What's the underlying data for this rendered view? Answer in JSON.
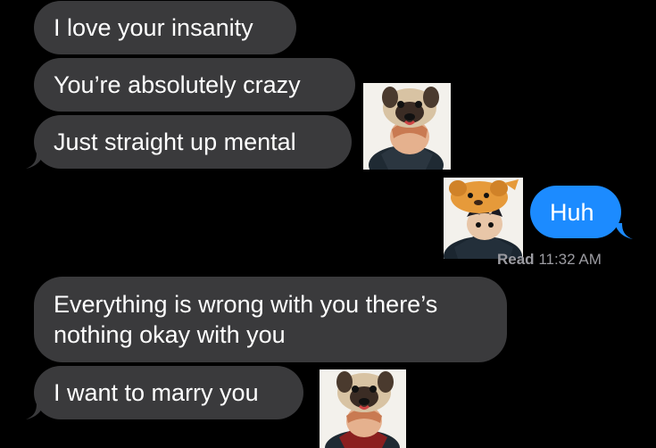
{
  "conversation": {
    "messages": [
      {
        "direction": "incoming",
        "text": "I love your insanity"
      },
      {
        "direction": "incoming",
        "text": "You’re absolutely crazy"
      },
      {
        "direction": "incoming",
        "text": "Just straight up mental"
      },
      {
        "direction": "outgoing",
        "text": "Huh"
      },
      {
        "direction": "incoming",
        "line1": "Everything is wrong with you there’s",
        "line2": "nothing okay with you"
      },
      {
        "direction": "incoming",
        "text": "I want to marry you"
      }
    ],
    "read_receipt": {
      "status": "Read",
      "time": "11:32 AM"
    },
    "colors": {
      "background": "#000000",
      "incoming_bubble": "#3a3a3c",
      "outgoing_bubble": "#1c8bff",
      "text": "#ffffff",
      "receipt": "#9b9ba1"
    },
    "stickers": [
      {
        "name": "pug-hat-character-sticker"
      },
      {
        "name": "orange-dog-hat-character-sticker"
      },
      {
        "name": "pug-hat-character-sticker"
      }
    ]
  }
}
